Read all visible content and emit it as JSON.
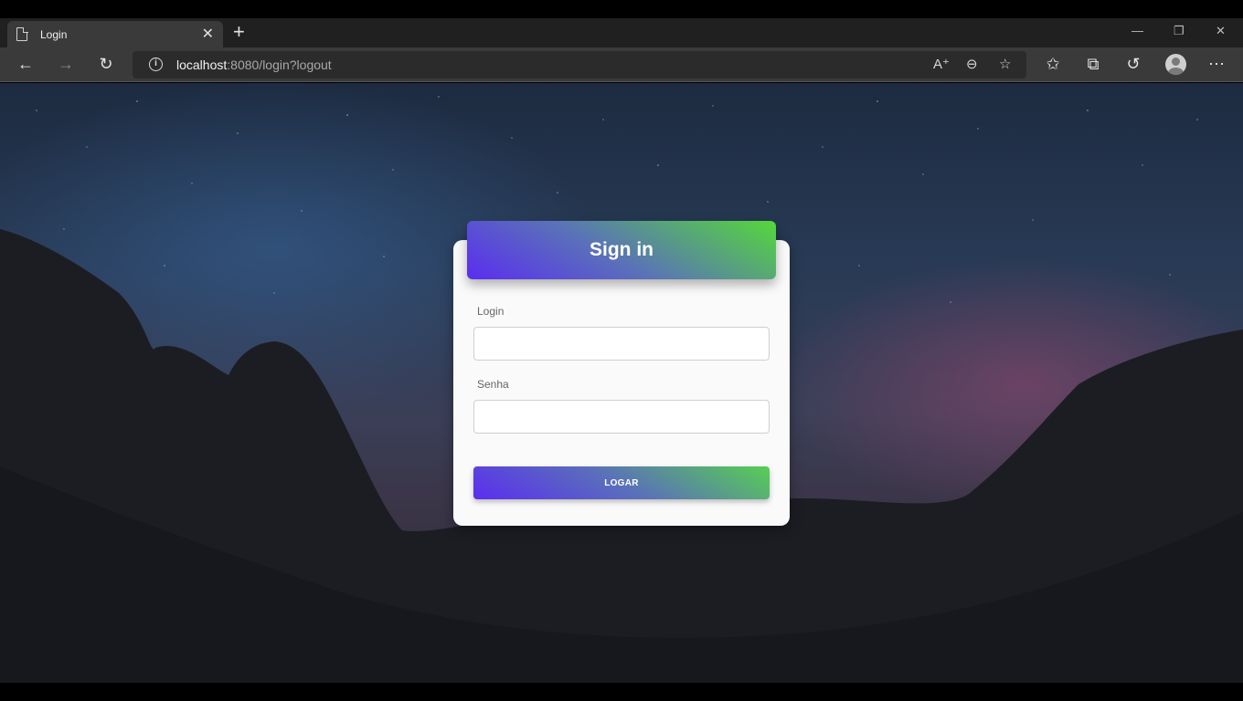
{
  "browser": {
    "tab_title": "Login",
    "tab_close": "✕",
    "new_tab": "+",
    "url_host": "localhost",
    "url_rest": ":8080/login?logout",
    "window_controls": {
      "minimize": "—",
      "restore": "❐",
      "close": "✕"
    },
    "icons": [
      "back-icon",
      "forward-icon",
      "refresh-icon",
      "site-info-icon",
      "read-aloud-icon",
      "zoom-out-icon",
      "add-favorite-icon",
      "favorites-icon",
      "collections-icon",
      "history-icon",
      "profile-icon",
      "more-icon"
    ]
  },
  "login": {
    "title": "Sign in",
    "login_label": "Login",
    "login_value": "",
    "password_label": "Senha",
    "password_value": "",
    "submit_label": "LOGAR"
  },
  "colors": {
    "gradient_start": "#5b2df0",
    "gradient_mid": "#5a72b8",
    "gradient_end": "#55d83a",
    "card_bg": "#fafafa"
  }
}
